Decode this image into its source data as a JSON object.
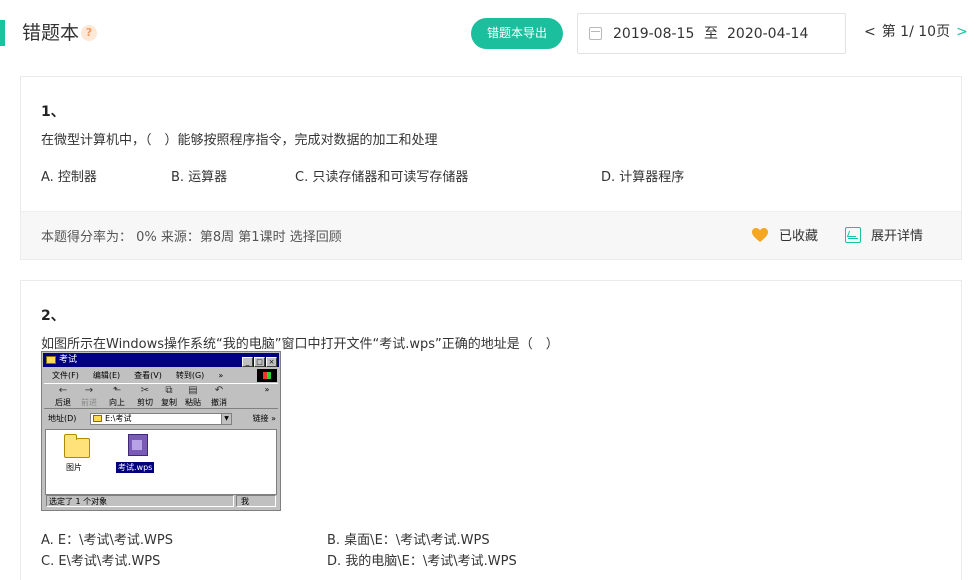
{
  "header": {
    "title": "错题本",
    "help_icon": "?",
    "export_label": "错题本导出",
    "date_start": "2019-08-15",
    "date_sep": "至",
    "date_end": "2020-04-14",
    "pager_prev": "<",
    "pager_text": "第 1/ 10页",
    "pager_next": ">"
  },
  "questions": [
    {
      "number": "1、",
      "text": "在微型计算机中，（　）能够按照程序指令，完成对数据的加工和处理",
      "options": [
        "A. 控制器",
        "B. 运算器",
        "C. 只读存储器和可读写存储器",
        "D. 计算器程序"
      ],
      "footer": "本题得分率为：  0%     来源：第8周 第1课时 选择回顾",
      "fav_label": "已收藏",
      "detail_label": "展开详情"
    },
    {
      "number": "2、",
      "text": "如图所示在Windows操作系统“我的电脑”窗口中打开文件“考试.wps”正确的地址是（　）",
      "options": [
        "A. E：\\考试\\考试.WPS",
        "B. 桌面\\E：\\考试\\考试.WPS",
        "C. E\\考试\\考试.WPS",
        "D. 我的电脑\\E：\\考试\\考试.WPS"
      ],
      "figure": {
        "title": "考试",
        "title_buttons": [
          "_",
          "□",
          "×"
        ],
        "menu": [
          "文件(F)",
          "编辑(E)",
          "查看(V)",
          "转到(G)",
          "»"
        ],
        "toolbar": [
          "后退",
          "前进",
          "向上",
          "剪切",
          "复制",
          "粘贴",
          "撤消",
          "»"
        ],
        "address_label": "地址(D)",
        "address_value": "E:\\考试",
        "address_links": "链接 »",
        "items": [
          "图片",
          "考试.wps"
        ],
        "status_left": "选定了 1 个对象",
        "status_right": "我"
      }
    }
  ],
  "colors": {
    "accent": "#18c3a0",
    "button": "#1bbf9e",
    "heart": "#f5a623"
  }
}
